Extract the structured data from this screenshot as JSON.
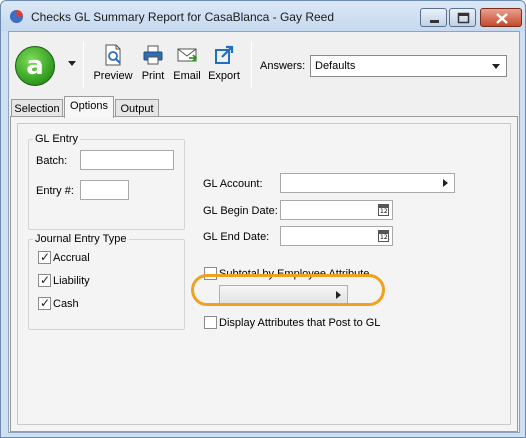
{
  "window": {
    "title": "Checks GL Summary Report for CasaBlanca - Gay Reed"
  },
  "toolbar": {
    "logo_letter": "a",
    "buttons": [
      {
        "label": "Preview",
        "icon": "preview-icon"
      },
      {
        "label": "Print",
        "icon": "printer-icon"
      },
      {
        "label": "Email",
        "icon": "envelope-icon"
      },
      {
        "label": "Export",
        "icon": "export-icon"
      }
    ],
    "answers_label": "Answers:",
    "answers_value": "Defaults"
  },
  "tabs": [
    {
      "label": "Selection",
      "active": false
    },
    {
      "label": "Options",
      "active": true
    },
    {
      "label": "Output",
      "active": false
    }
  ],
  "gl_entry": {
    "title": "GL Entry",
    "batch_label": "Batch:",
    "batch_value": "",
    "entry_label": "Entry #:",
    "entry_value": ""
  },
  "journal_entry_type": {
    "title": "Journal Entry Type",
    "options": [
      {
        "label": "Accrual",
        "checked": true
      },
      {
        "label": "Liability",
        "checked": true
      },
      {
        "label": "Cash",
        "checked": true
      }
    ]
  },
  "gl_fields": {
    "account_label": "GL Account:",
    "account_value": "",
    "begin_date_label": "GL Begin Date:",
    "begin_date_value": "",
    "end_date_label": "GL End Date:",
    "end_date_value": "",
    "calendar_glyph": "12"
  },
  "options": {
    "subtotal_label": "Subtotal by Employee Attribute",
    "subtotal_checked": false,
    "subtotal_attribute_value": "",
    "display_attributes_label": "Display Attributes that Post to GL",
    "display_attributes_checked": false
  },
  "colors": {
    "highlight": "#f0a21e",
    "logo_green": "#2e9a1c",
    "titlebar": "#c6d9ef"
  }
}
